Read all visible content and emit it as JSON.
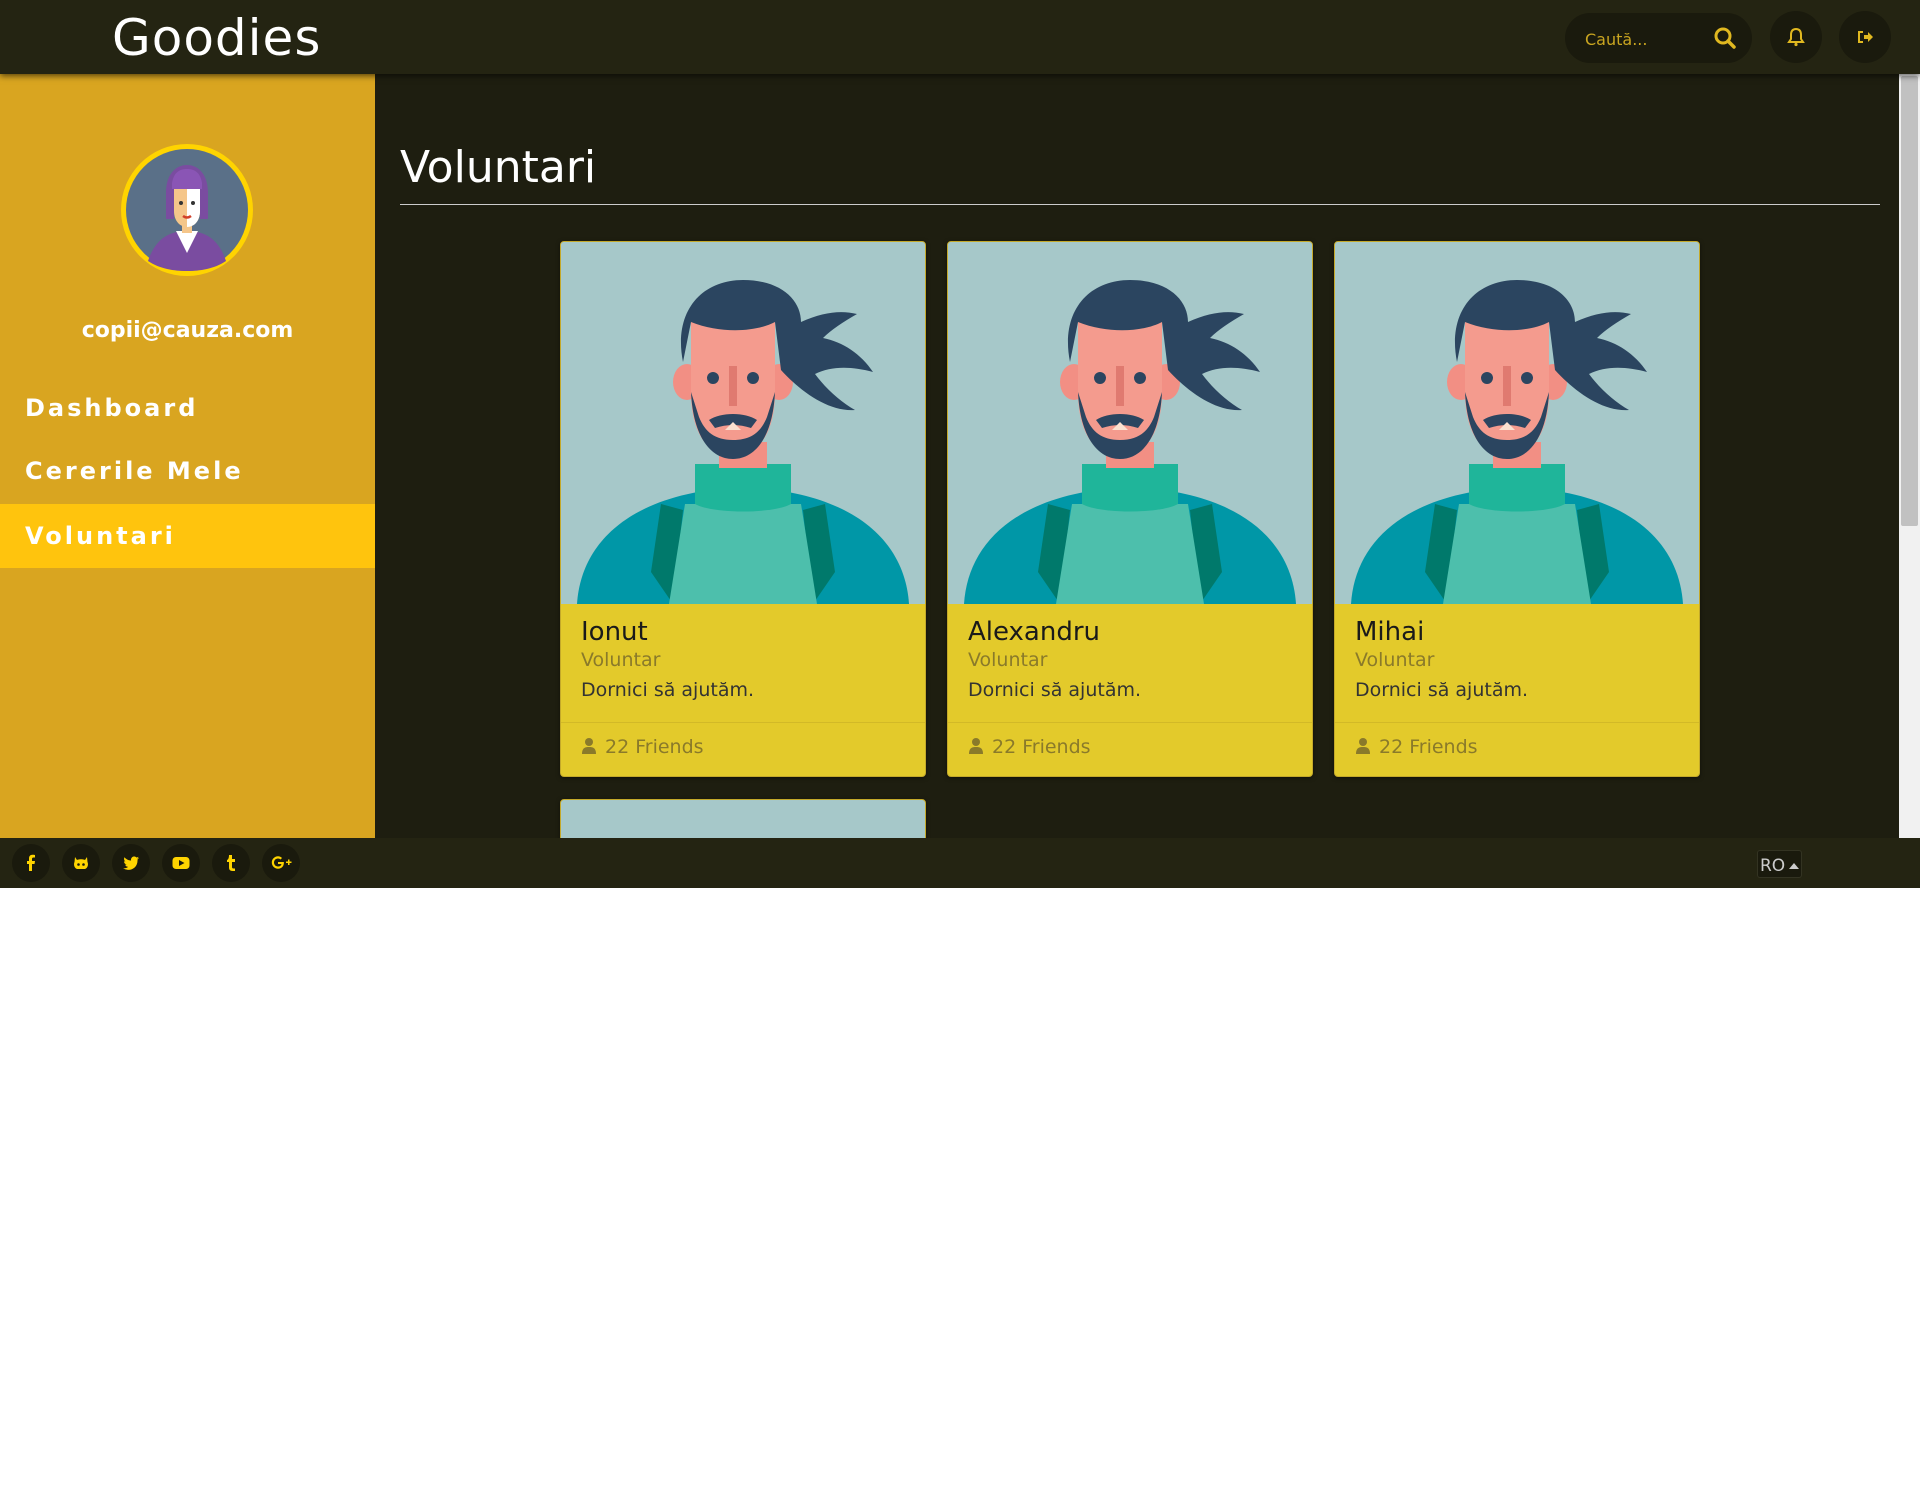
{
  "header": {
    "brand": "Goodies",
    "search_placeholder": "Caută..."
  },
  "sidebar": {
    "email": "copii@cauza.com",
    "items": [
      {
        "label": "Dashboard",
        "active": false
      },
      {
        "label": "Cererile Mele",
        "active": false
      },
      {
        "label": "Voluntari",
        "active": true
      }
    ]
  },
  "main": {
    "title": "Voluntari",
    "cards": [
      {
        "name": "Ionut",
        "role": "Voluntar",
        "desc": "Dornici să ajutăm.",
        "friends": "22 Friends"
      },
      {
        "name": "Alexandru",
        "role": "Voluntar",
        "desc": "Dornici să ajutăm.",
        "friends": "22 Friends"
      },
      {
        "name": "Mihai",
        "role": "Voluntar",
        "desc": "Dornici să ajutăm.",
        "friends": "22 Friends"
      }
    ]
  },
  "footer": {
    "social": [
      "facebook-icon",
      "github-icon",
      "twitter-icon",
      "youtube-icon",
      "tumblr-icon",
      "google-plus-icon"
    ],
    "language": "RO"
  },
  "colors": {
    "topbar": "#242412",
    "sidebar": "#d9a520",
    "active_nav": "#ffc40d",
    "card": "#e3ca2b",
    "accent": "#ffd400",
    "main_bg": "#1e1e10"
  }
}
